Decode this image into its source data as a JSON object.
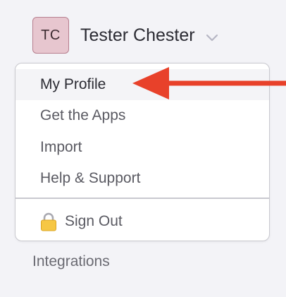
{
  "user": {
    "initials": "TC",
    "name": "Tester Chester",
    "avatar_color": "#e7c6cf"
  },
  "menu": {
    "items": [
      {
        "label": "My Profile"
      },
      {
        "label": "Get the Apps"
      },
      {
        "label": "Import"
      },
      {
        "label": "Help & Support"
      }
    ],
    "sign_out": {
      "label": "Sign Out",
      "icon": "lock-icon"
    }
  },
  "sidebar": {
    "integrations_label": "Integrations"
  },
  "annotation": {
    "arrow_color": "#e8412a",
    "points_to": "My Profile"
  }
}
